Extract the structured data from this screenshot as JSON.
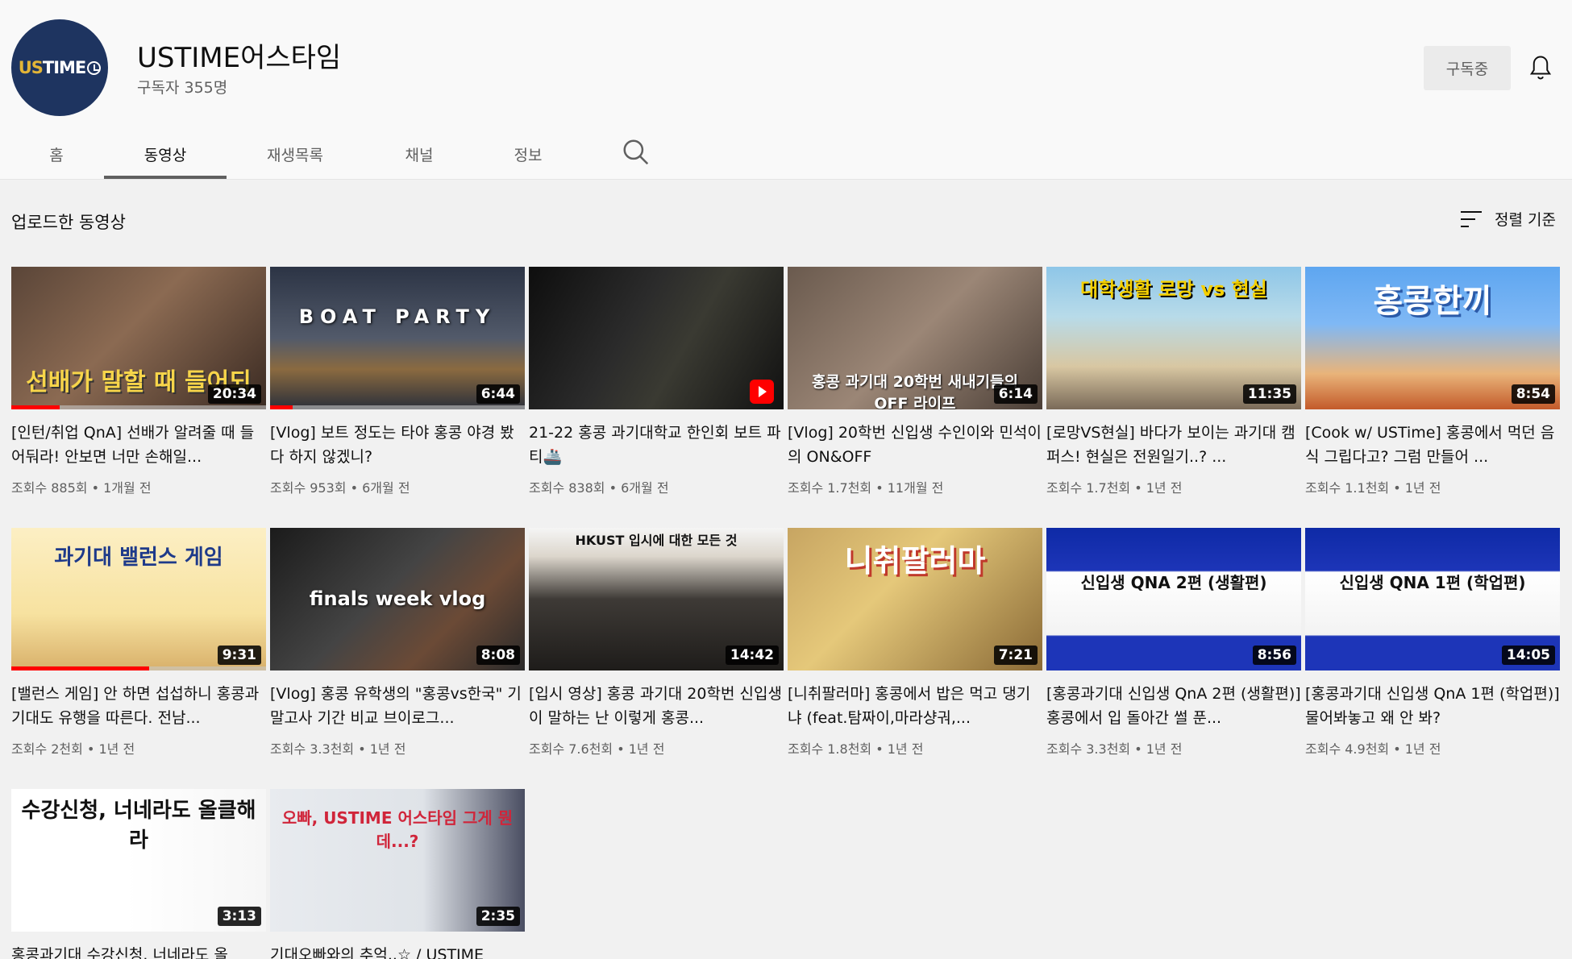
{
  "channel": {
    "logo_text": "USTIME",
    "name": "USTIME어스타임",
    "subscribers": "구독자 355명",
    "subscribe_label": "구독중"
  },
  "tabs": [
    {
      "label": "홈"
    },
    {
      "label": "동영상",
      "active": true
    },
    {
      "label": "재생목록"
    },
    {
      "label": "채널"
    },
    {
      "label": "정보"
    }
  ],
  "section": {
    "title": "업로드한 동영상",
    "sort_label": "정렬 기준"
  },
  "videos": [
    {
      "title": "[인턴/취업 QnA] 선배가 알려줄 때 들어둬라! 안보면 너만 손해일...",
      "views": "조회수 885회",
      "age": "1개월 전",
      "duration": "20:34",
      "progress": 0.19,
      "overlay": "선배가 말할 때 들어되"
    },
    {
      "title": "[Vlog] 보트 정도는 타야 홍콩 야경 봤다 하지 않겠니?",
      "views": "조회수 953회",
      "age": "6개월 전",
      "duration": "6:44",
      "progress": 0.09,
      "overlay": "BOAT PARTY"
    },
    {
      "title": "21-22 홍콩 과기대학교 한인회 보트 파티🚢",
      "views": "조회수 838회",
      "age": "6개월 전",
      "duration": "",
      "progress": 0,
      "overlay": ""
    },
    {
      "title": "[Vlog] 20학번 신입생 수인이와 민석이의 ON&OFF",
      "views": "조회수 1.7천회",
      "age": "11개월 전",
      "duration": "6:14",
      "progress": 0,
      "overlay": "홍콩 과기대 20학번 새내기들의 OFF 라이프"
    },
    {
      "title": "[로망VS현실] 바다가 보이는 과기대 캠퍼스! 현실은 전원일기..? ...",
      "views": "조회수 1.7천회",
      "age": "1년 전",
      "duration": "11:35",
      "progress": 0,
      "overlay": "대학생활 로망 vs 현실"
    },
    {
      "title": "[Cook w/ USTime] 홍콩에서 먹던 음식 그립다고? 그럼 만들어 ...",
      "views": "조회수 1.1천회",
      "age": "1년 전",
      "duration": "8:54",
      "progress": 0,
      "overlay": "홍콩한끼"
    },
    {
      "title": "[밸런스 게임] 안 하면 섭섭하니 홍콩과기대도 유행을 따른다. 전남...",
      "views": "조회수 2천회",
      "age": "1년 전",
      "duration": "9:31",
      "progress": 0.54,
      "overlay": "과기대 밸런스 게임"
    },
    {
      "title": "[Vlog] 홍콩 유학생의 \"홍콩vs한국\" 기말고사 기간 비교 브이로그...",
      "views": "조회수 3.3천회",
      "age": "1년 전",
      "duration": "8:08",
      "progress": 0,
      "overlay": "finals week vlog"
    },
    {
      "title": "[입시 영상] 홍콩 과기대 20학번 신입생이 말하는 난 이렇게 홍콩...",
      "views": "조회수 7.6천회",
      "age": "1년 전",
      "duration": "14:42",
      "progress": 0,
      "overlay": "HKUST 입시에 대한 모든 것"
    },
    {
      "title": "[니취팔러마] 홍콩에서 밥은 먹고 댕기냐 (feat.탐짜이,마라샹궈,...",
      "views": "조회수 1.8천회",
      "age": "1년 전",
      "duration": "7:21",
      "progress": 0,
      "overlay": "니취팔러마"
    },
    {
      "title": "[홍콩과기대 신입생 QnA 2편 (생활편)] 홍콩에서 입 돌아간 썰 푼...",
      "views": "조회수 3.3천회",
      "age": "1년 전",
      "duration": "8:56",
      "progress": 0,
      "overlay": "신입생 QNA 2편 (생활편)"
    },
    {
      "title": "[홍콩과기대 신입생 QnA 1편 (학업편)] 물어봐놓고 왜 안 봐?",
      "views": "조회수 4.9천회",
      "age": "1년 전",
      "duration": "14:05",
      "progress": 0,
      "overlay": "신입생 QNA 1편 (학업편)"
    },
    {
      "title": "홍콩과기대 수강신청. 너네라도 올",
      "views": "",
      "age": "",
      "duration": "3:13",
      "progress": 0,
      "overlay": "수강신청, 너네라도 올클해라"
    },
    {
      "title": "기대오빠와의 추억..☆ / USTIME",
      "views": "",
      "age": "",
      "duration": "2:35",
      "progress": 0,
      "overlay": "오빠, USTIME 어스타임 그게 뭔데...?"
    }
  ]
}
